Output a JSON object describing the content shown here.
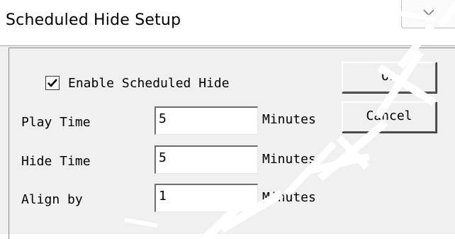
{
  "window": {
    "title": "Scheduled Hide Setup"
  },
  "enable_checkbox": {
    "label": "Enable Scheduled Hide",
    "checked": true
  },
  "fields": [
    {
      "label": "Play Time",
      "value": "5",
      "unit": "Minutes"
    },
    {
      "label": "Hide Time",
      "value": "5",
      "unit": "Minutes"
    },
    {
      "label": "Align by",
      "value": "1",
      "unit": "Minutes"
    }
  ],
  "buttons": {
    "ok": "Ok",
    "cancel": "Cancel"
  },
  "icons": {
    "close": "close-icon",
    "check": "checkmark-icon"
  }
}
